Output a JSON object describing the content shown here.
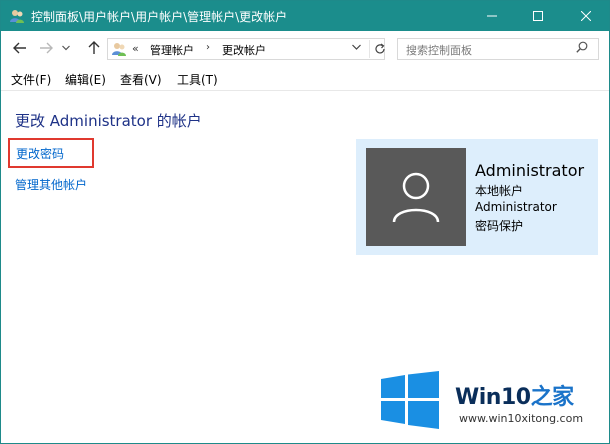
{
  "window": {
    "title": "控制面板\\用户帐户\\用户帐户\\管理帐户\\更改帐户"
  },
  "address": {
    "overflow": "«",
    "crumbs": [
      "管理帐户",
      "更改帐户"
    ],
    "separator": "›"
  },
  "search": {
    "placeholder": "搜索控制面板"
  },
  "menu": [
    {
      "label": "文件(F)"
    },
    {
      "label": "编辑(E)"
    },
    {
      "label": "查看(V)"
    },
    {
      "label": "工具(T)"
    }
  ],
  "content": {
    "title": "更改 Administrator 的帐户",
    "links": {
      "change_password": "更改密码",
      "manage_other": "管理其他帐户"
    }
  },
  "account": {
    "name": "Administrator",
    "type": "本地帐户",
    "group": "Administrator",
    "protection": "密码保护"
  },
  "watermark": {
    "brand": "Win10",
    "brand_suffix": "之家",
    "url": "www.win10xitong.com"
  },
  "colors": {
    "titlebar": "#1b8d8c",
    "link": "#0066cc",
    "heading": "#1e3287",
    "highlight_border": "#e0392f",
    "card_bg": "#ddeefc",
    "avatar_bg": "#595959"
  },
  "icons": [
    "user-accounts-icon",
    "minimize-icon",
    "maximize-icon",
    "close-icon",
    "back-arrow-icon",
    "forward-arrow-icon",
    "recent-dropdown-icon",
    "up-arrow-icon",
    "address-dropdown-icon",
    "refresh-icon",
    "search-icon",
    "user-avatar-icon",
    "windows-logo-icon"
  ]
}
